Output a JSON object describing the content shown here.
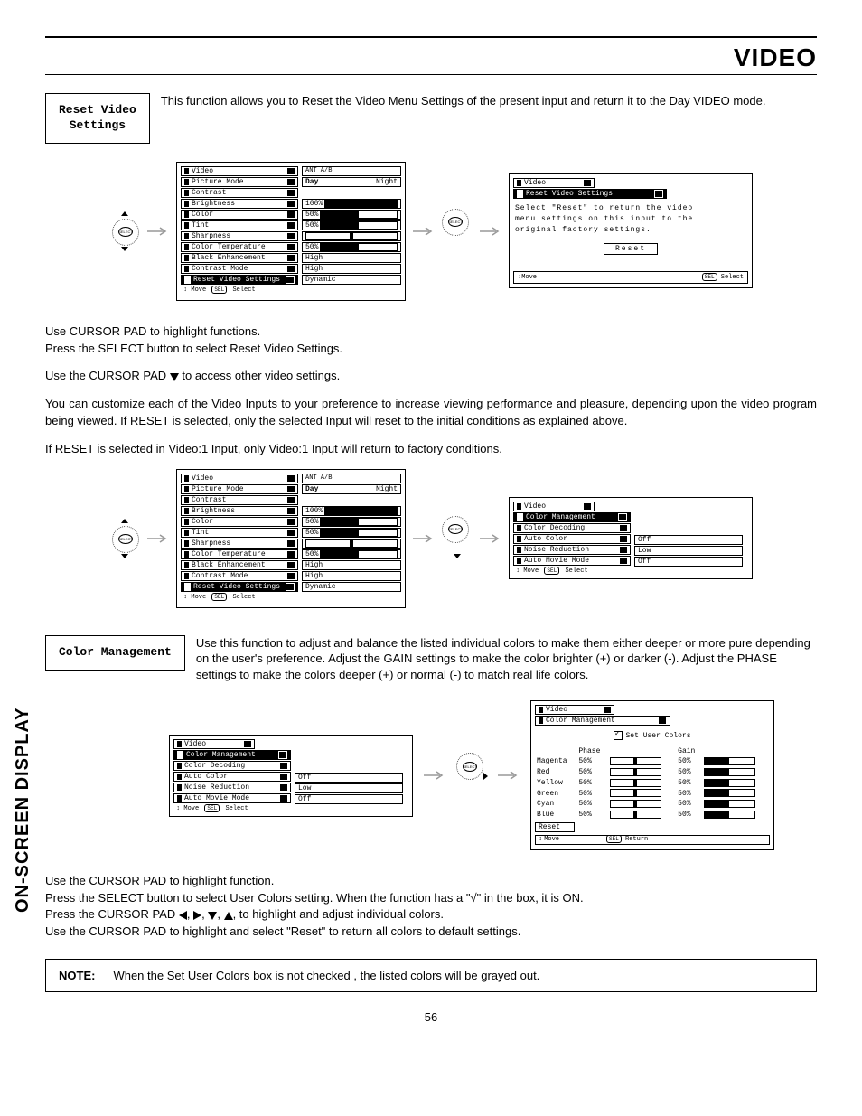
{
  "page_title": "VIDEO",
  "side_label": "ON-SCREEN DISPLAY",
  "page_number": "56",
  "section1": {
    "label": "Reset Video\nSettings",
    "desc": "This function allows you to Reset the Video Menu Settings of the present input and return it to the Day VIDEO mode."
  },
  "osd1": {
    "title": "Video",
    "source": "ANT A/B",
    "pm_day": "Day",
    "pm_night": "Night",
    "rows": [
      {
        "l": "Picture Mode"
      },
      {
        "l": "Contrast",
        "v": "100%",
        "pct": 100
      },
      {
        "l": "Brightness",
        "v": "50%",
        "pct": 50
      },
      {
        "l": "Color",
        "v": "50%",
        "pct": 50
      },
      {
        "l": "Tint",
        "tick": 50
      },
      {
        "l": "Sharpness",
        "v": "50%",
        "pct": 50
      },
      {
        "l": "Color Temperature",
        "v": "High"
      },
      {
        "l": "Black Enhancement",
        "v": "High"
      },
      {
        "l": "Contrast Mode",
        "v": "Dynamic"
      },
      {
        "l": "Reset Video Settings",
        "hl": true
      }
    ],
    "footer": "Move",
    "footer2": "Select"
  },
  "osd_reset": {
    "title": "Video",
    "sub": "Reset Video Settings",
    "msg_l1": "Select \"Reset\" to return the video",
    "msg_l2": "menu settings on this input to the",
    "msg_l3": "original factory settings.",
    "btn": "Reset",
    "f1": "Move",
    "f2": "Select"
  },
  "para1": "Use CURSOR PAD to highlight functions.",
  "para2": "Press the SELECT button to select Reset Video Settings.",
  "para3_pre": "Use the CURSOR PAD ",
  "para3_post": " to access other video settings.",
  "para4": "You can customize each of the Video Inputs to your preference to increase viewing performance and pleasure, depending upon the video program being viewed. If RESET is selected, only the selected Input will reset to the initial conditions as explained above.",
  "para5": "If RESET is selected in Video:1 Input, only Video:1 Input will return to factory conditions.",
  "osd2": {
    "title": "Video",
    "source": "ANT A/B",
    "rows2": [
      {
        "l": "Color Management",
        "hl": true
      },
      {
        "l": "Color Decoding"
      },
      {
        "l": "Auto Color",
        "v": "Off"
      },
      {
        "l": "Noise Reduction",
        "v": "Low"
      },
      {
        "l": "Auto Movie Mode",
        "v": "Off"
      }
    ]
  },
  "section2": {
    "label": "Color Management",
    "desc": "Use this function to adjust and balance the listed individual colors to make them either deeper or more pure depending on the user's preference.  Adjust the GAIN settings to make the color brighter (+) or darker (-).  Adjust the PHASE settings to make the colors deeper (+) or normal (-) to match real life colors."
  },
  "osd3": {
    "title": "Video",
    "rows3": [
      {
        "l": "Color Management",
        "hl": true
      },
      {
        "l": "Color Decoding"
      },
      {
        "l": "Auto Color",
        "v": "Off"
      },
      {
        "l": "Noise Reduction",
        "v": "Low"
      },
      {
        "l": "Auto Movie Mode",
        "v": "Off"
      }
    ]
  },
  "osd4": {
    "title": "Video",
    "sub": "Color Management",
    "setuser": "Set User Colors",
    "h_phase": "Phase",
    "h_gain": "Gain",
    "rows": [
      {
        "n": "Magenta",
        "p": "50%",
        "g": "50%"
      },
      {
        "n": "Red",
        "p": "50%",
        "g": "50%"
      },
      {
        "n": "Yellow",
        "p": "50%",
        "g": "50%"
      },
      {
        "n": "Green",
        "p": "50%",
        "g": "50%"
      },
      {
        "n": "Cyan",
        "p": "50%",
        "g": "50%"
      },
      {
        "n": "Blue",
        "p": "50%",
        "g": "50%"
      }
    ],
    "reset": "Reset",
    "f1": "Move",
    "f2": "Return"
  },
  "inst1": "Use the CURSOR PAD to highlight function.",
  "inst2_a": "Press the SELECT button to select User Colors setting.  When the function has a \"",
  "inst2_b": "\" in the box, it is ON.",
  "inst3_a": "Press  the CURSOR PAD ",
  "inst3_b": ", to highlight and adjust individual colors.",
  "inst4": "Use  the CURSOR PAD to highlight and select \"Reset\" to return all colors to default settings.",
  "note_label": "NOTE:",
  "note_text": "When the Set User Colors box is not checked , the listed colors will be grayed out.",
  "icons": {
    "select_label": "SELECT",
    "sel": "SEL"
  }
}
